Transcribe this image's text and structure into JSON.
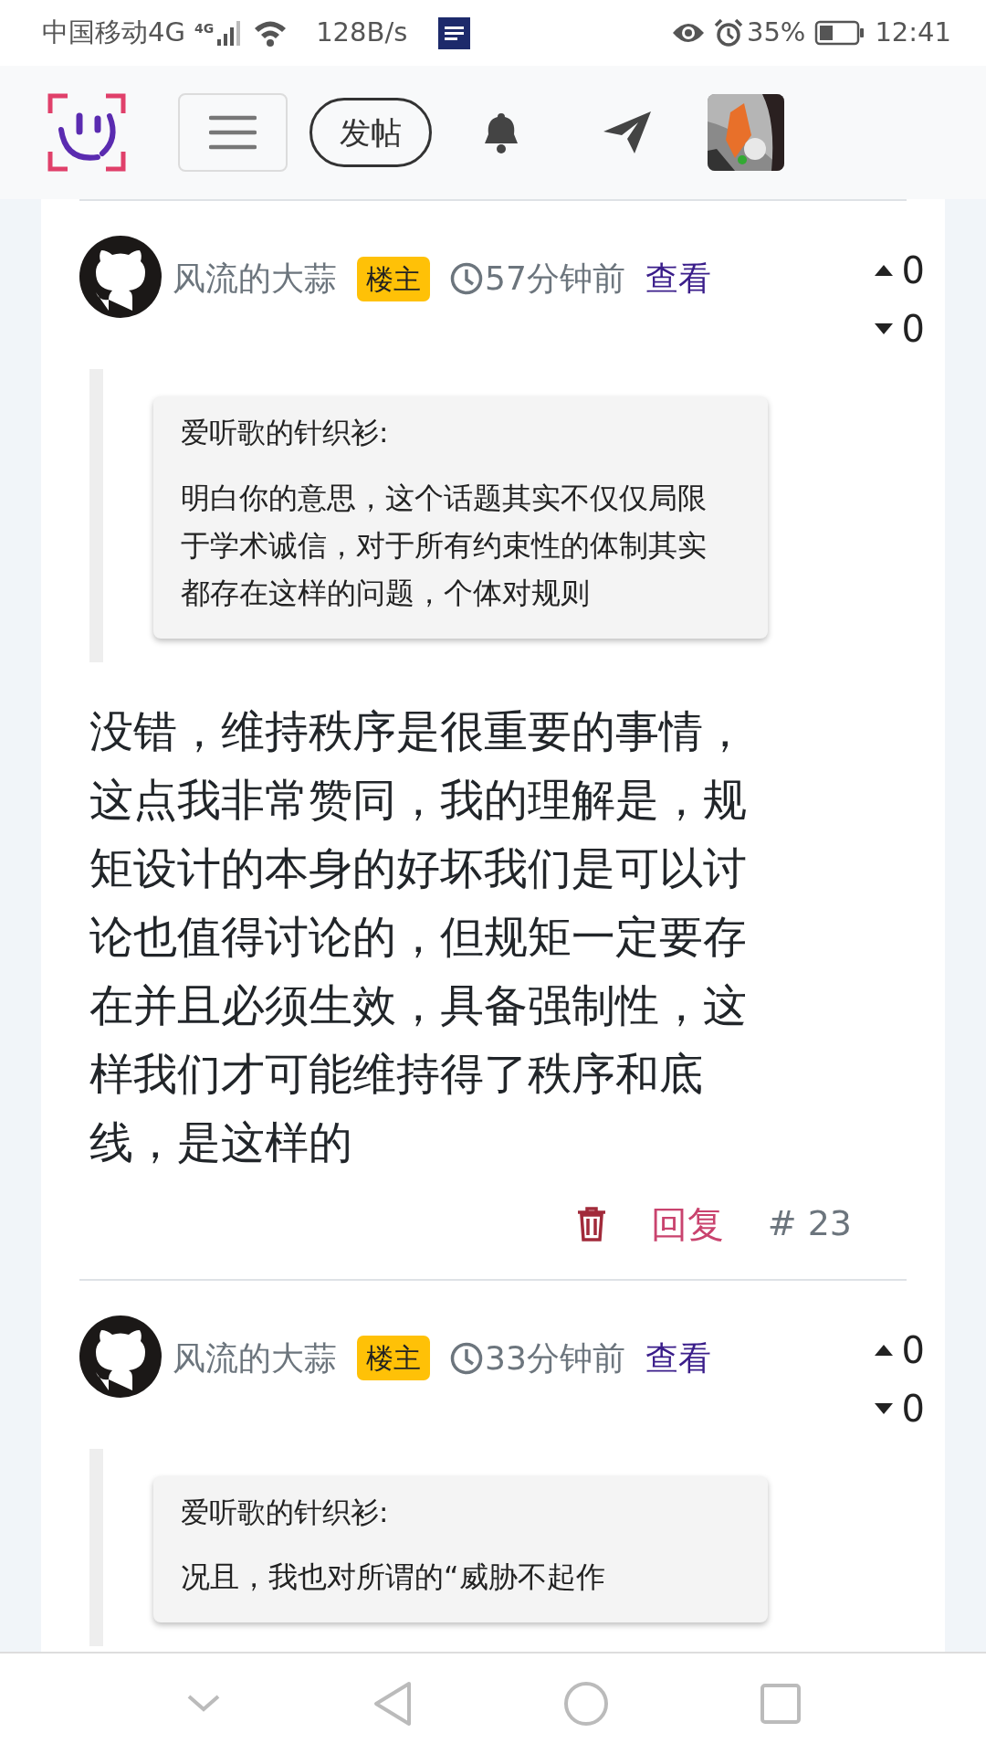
{
  "status_bar": {
    "carrier": "中国移动4G",
    "network": "4G",
    "speed": "128B/s",
    "battery": "35%",
    "time": "12:41"
  },
  "header": {
    "post_button": "发帖"
  },
  "posts": [
    {
      "author": "风流的大蒜",
      "badge": "楼主",
      "time": "57分钟前",
      "view_link": "查看",
      "upvotes": "0",
      "downvotes": "0",
      "quote": {
        "author": "爱听歌的针织衫:",
        "text": "明白你的意思，这个话题其实不仅仅局限于学术诚信，对于所有约束性的体制其实都存在这样的问题，个体对规则"
      },
      "body": "没错，维持秩序是很重要的事情，这点我非常赞同，我的理解是，规矩设计的本身的好坏我们是可以讨论也值得讨论的，但规矩一定要存在并且必须生效，具备强制性，这样我们才可能维持得了秩序和底线，是这样的",
      "reply": "回复",
      "floor": "# 23"
    },
    {
      "author": "风流的大蒜",
      "badge": "楼主",
      "time": "33分钟前",
      "view_link": "查看",
      "upvotes": "0",
      "downvotes": "0",
      "quote": {
        "author": "爱听歌的针织衫:",
        "text": "况且，我也对所谓的“威胁不起作"
      }
    }
  ]
}
